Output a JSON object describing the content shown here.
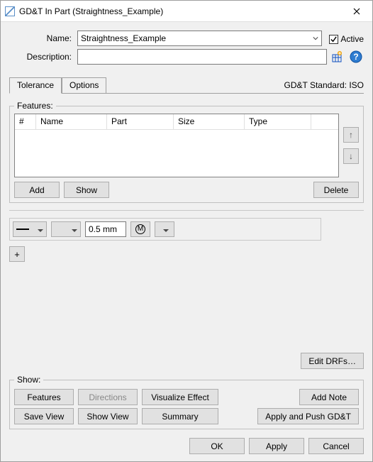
{
  "window": {
    "title": "GD&T In Part (Straightness_Example)"
  },
  "form": {
    "name_label": "Name:",
    "name_value": "Straightness_Example",
    "active_label": "Active",
    "active_checked": true,
    "description_label": "Description:",
    "description_value": ""
  },
  "tabs": {
    "tolerance": "Tolerance",
    "options": "Options"
  },
  "standard": "GD&T Standard: ISO",
  "features": {
    "legend": "Features:",
    "columns": {
      "num": "#",
      "name": "Name",
      "part": "Part",
      "size": "Size",
      "type": "Type"
    },
    "rows": [],
    "add": "Add",
    "show": "Show",
    "delete": "Delete",
    "move_up": "↑",
    "move_down": "↓"
  },
  "spec": {
    "symbol": "straightness",
    "zone": "",
    "value": "0.5 mm",
    "modifier": "M",
    "datum": "",
    "plus": "+"
  },
  "edit_drfs": "Edit DRFs…",
  "show": {
    "legend": "Show:",
    "features": "Features",
    "directions": "Directions",
    "visualize": "Visualize Effect",
    "add_note": "Add Note",
    "save_view": "Save View",
    "show_view": "Show View",
    "summary": "Summary",
    "apply_push": "Apply and Push GD&T"
  },
  "footer": {
    "ok": "OK",
    "apply": "Apply",
    "cancel": "Cancel"
  }
}
